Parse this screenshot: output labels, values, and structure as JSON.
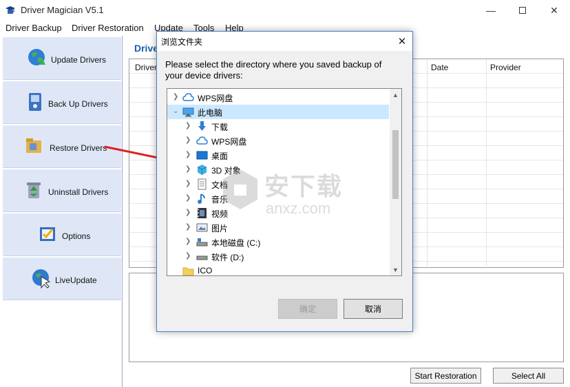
{
  "app": {
    "title": "Driver Magician V5.1"
  },
  "menu": [
    "Driver Backup",
    "Driver Restoration",
    "Update",
    "Tools",
    "Help"
  ],
  "sidebar": {
    "items": [
      {
        "label": "Update Drivers",
        "icon": "globe-update-icon"
      },
      {
        "label": "Back Up Drivers",
        "icon": "backup-icon"
      },
      {
        "label": "Restore Drivers",
        "icon": "restore-icon"
      },
      {
        "label": "Uninstall Drivers",
        "icon": "recycle-bin-icon"
      },
      {
        "label": "Options",
        "icon": "options-icon"
      },
      {
        "label": "LiveUpdate",
        "icon": "live-update-icon"
      }
    ]
  },
  "main": {
    "header": "Drive",
    "columns": [
      "Driver",
      "Date",
      "Provider"
    ],
    "buttons": {
      "start": "Start Restoration",
      "select_all": "Select All"
    }
  },
  "dialog": {
    "title": "浏览文件夹",
    "prompt": "Please select the directory where you saved backup of your device drivers:",
    "tree": [
      {
        "label": "WPS网盘",
        "icon": "cloud-icon",
        "level": 0,
        "expanded": false
      },
      {
        "label": "此电脑",
        "icon": "computer-icon",
        "level": 0,
        "expanded": true,
        "selected": true
      },
      {
        "label": "下载",
        "icon": "download-icon",
        "level": 1
      },
      {
        "label": "WPS网盘",
        "icon": "cloud-icon",
        "level": 1
      },
      {
        "label": "桌面",
        "icon": "desktop-icon",
        "level": 1
      },
      {
        "label": "3D 对象",
        "icon": "cube-icon",
        "level": 1
      },
      {
        "label": "文档",
        "icon": "document-icon",
        "level": 1
      },
      {
        "label": "音乐",
        "icon": "music-icon",
        "level": 1
      },
      {
        "label": "视频",
        "icon": "video-icon",
        "level": 1
      },
      {
        "label": "图片",
        "icon": "picture-icon",
        "level": 1
      },
      {
        "label": "本地磁盘 (C:)",
        "icon": "drive-c-icon",
        "level": 1
      },
      {
        "label": "软件 (D:)",
        "icon": "drive-d-icon",
        "level": 1
      },
      {
        "label": "ICO",
        "icon": "folder-icon",
        "level": 0
      }
    ],
    "ok": "确定",
    "cancel": "取消"
  },
  "watermark": {
    "text": "安下载",
    "sub": "anxz.com"
  },
  "colors": {
    "sidebar_button": "#dfe7f7",
    "header_blue": "#1a5fa8",
    "arrow_red": "#e02020",
    "selection": "#cce8ff"
  }
}
